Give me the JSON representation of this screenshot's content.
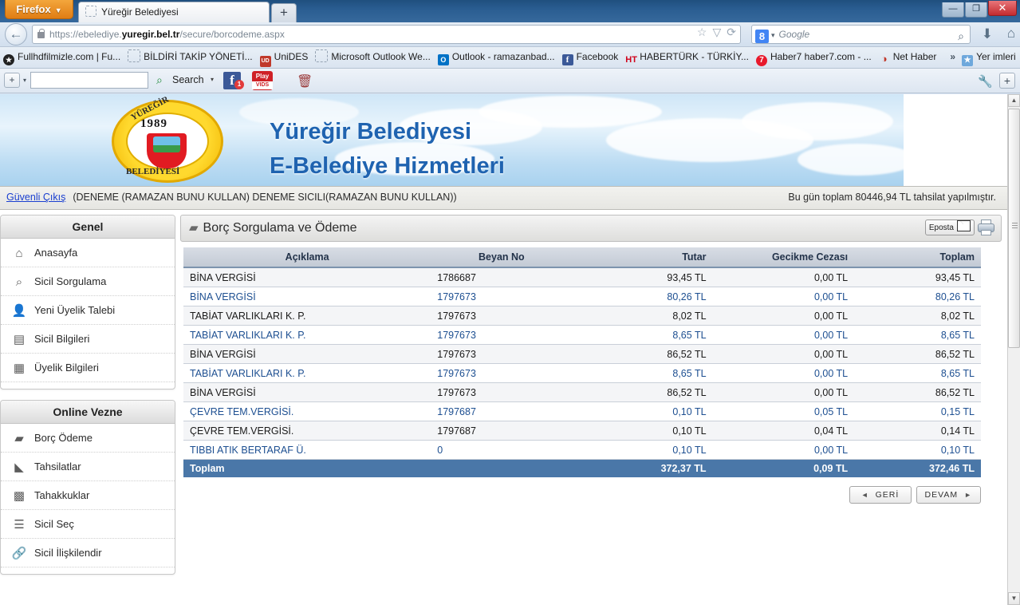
{
  "browser": {
    "firefox_button": "Firefox",
    "tab_title": "Yüreğir Belediyesi",
    "newtab_label": "+",
    "window_minimize": "—",
    "window_restore": "❐",
    "window_close": "✕",
    "url_scheme": "https://ebelediye.",
    "url_domain": "yuregir.bel.tr",
    "url_path": "/secure/borcodeme.aspx",
    "search_engine": "Google",
    "search_placeholder": "Google",
    "google_mark": "8"
  },
  "bookmarks": [
    {
      "label": "Fullhdfilmizle.com | Fu...",
      "icon": "film-icon",
      "glyph": "★"
    },
    {
      "label": "BİLDİRİ TAKİP YÖNETİ...",
      "icon": "blank-favicon",
      "glyph": ""
    },
    {
      "label": "UniDES",
      "icon": "unides-icon",
      "glyph": "UD"
    },
    {
      "label": "Microsoft Outlook We...",
      "icon": "blank-favicon",
      "glyph": ""
    },
    {
      "label": "Outlook - ramazanbad...",
      "icon": "outlook-icon",
      "glyph": "O"
    },
    {
      "label": "Facebook",
      "icon": "facebook-icon",
      "glyph": "f"
    },
    {
      "label": "HABERTÜRK - TÜRKİY...",
      "icon": "haberturk-icon",
      "glyph": "HT"
    },
    {
      "label": "Haber7 haber7.com - ...",
      "icon": "haber7-icon",
      "glyph": "7"
    },
    {
      "label": "Net Haber",
      "icon": "nethaber-icon",
      "glyph": "◑"
    }
  ],
  "bookmarks_overflow": "»",
  "bookmarks_folder": "Yer imleri",
  "addonbar": {
    "plus_label": "+",
    "input_value": "",
    "search_label": "Search",
    "facebook_badge": "1",
    "playvids_line1": "Play",
    "playvids_line2": "VIDS"
  },
  "site": {
    "title_line1": "Yüreğir Belediyesi",
    "title_line2": "E-Belediye Hizmetleri",
    "logo_year": "1989",
    "logo_top_text": "YÜREĞİR",
    "logo_bottom_text": "BELEDİYESİ"
  },
  "userbar": {
    "logout_link": "Güvenli Çıkış",
    "user_info": "(DENEME (RAMAZAN BUNU KULLAN) DENEME SICILI(RAMAZAN BUNU KULLAN))",
    "daily_total": "Bu gün toplam 80446,94 TL tahsilat yapılmıştır."
  },
  "sidebar": {
    "sections": [
      {
        "title": "Genel",
        "items": [
          {
            "label": "Anasayfa",
            "icon": "home-icon",
            "glyph": "⌂"
          },
          {
            "label": "Sicil Sorgulama",
            "icon": "magnifier-icon",
            "glyph": "⌕"
          },
          {
            "label": "Yeni Üyelik Talebi",
            "icon": "add-user-icon",
            "glyph": "👤"
          },
          {
            "label": "Sicil Bilgileri",
            "icon": "document-icon",
            "glyph": "▤"
          },
          {
            "label": "Üyelik Bilgileri",
            "icon": "document-edit-icon",
            "glyph": "▦"
          }
        ]
      },
      {
        "title": "Online Vezne",
        "items": [
          {
            "label": "Borç Ödeme",
            "icon": "cards-icon",
            "glyph": "▱"
          },
          {
            "label": "Tahsilatlar",
            "icon": "chart-down-icon",
            "glyph": "◣"
          },
          {
            "label": "Tahakkuklar",
            "icon": "bar-chart-icon",
            "glyph": "▮"
          },
          {
            "label": "Sicil Seç",
            "icon": "list-edit-icon",
            "glyph": "☰"
          },
          {
            "label": "Sicil İlişkilendir",
            "icon": "link-icon",
            "glyph": "🔗"
          }
        ]
      }
    ]
  },
  "main": {
    "panel_title": "Borç Sorgulama ve Ödeme",
    "panel_icon": "cards-icon",
    "eposta_button": "Eposta",
    "print_icon": "printer-icon",
    "back_button": "GERİ",
    "next_button": "DEVAM",
    "back_arrow": "◄",
    "next_arrow": "►"
  },
  "table": {
    "headers": [
      "Açıklama",
      "Beyan No",
      "Tutar",
      "Gecikme Cezası",
      "Toplam"
    ],
    "rows": [
      {
        "aciklama": "BİNA VERGİSİ",
        "beyan": "1786687",
        "tutar": "93,45 TL",
        "gecikme": "0,00 TL",
        "toplam": "93,45 TL",
        "blue": false
      },
      {
        "aciklama": "BİNA VERGİSİ",
        "beyan": "1797673",
        "tutar": "80,26 TL",
        "gecikme": "0,00 TL",
        "toplam": "80,26 TL",
        "blue": true
      },
      {
        "aciklama": "TABİAT VARLIKLARI K. P.",
        "beyan": "1797673",
        "tutar": "8,02 TL",
        "gecikme": "0,00 TL",
        "toplam": "8,02 TL",
        "blue": false
      },
      {
        "aciklama": "TABİAT VARLIKLARI K. P.",
        "beyan": "1797673",
        "tutar": "8,65 TL",
        "gecikme": "0,00 TL",
        "toplam": "8,65 TL",
        "blue": true
      },
      {
        "aciklama": "BİNA VERGİSİ",
        "beyan": "1797673",
        "tutar": "86,52 TL",
        "gecikme": "0,00 TL",
        "toplam": "86,52 TL",
        "blue": false
      },
      {
        "aciklama": "TABİAT VARLIKLARI K. P.",
        "beyan": "1797673",
        "tutar": "8,65 TL",
        "gecikme": "0,00 TL",
        "toplam": "8,65 TL",
        "blue": true
      },
      {
        "aciklama": "BİNA VERGİSİ",
        "beyan": "1797673",
        "tutar": "86,52 TL",
        "gecikme": "0,00 TL",
        "toplam": "86,52 TL",
        "blue": false
      },
      {
        "aciklama": "ÇEVRE TEM.VERGİSİ.",
        "beyan": "1797687",
        "tutar": "0,10 TL",
        "gecikme": "0,05 TL",
        "toplam": "0,15 TL",
        "blue": true
      },
      {
        "aciklama": "ÇEVRE TEM.VERGİSİ.",
        "beyan": "1797687",
        "tutar": "0,10 TL",
        "gecikme": "0,04 TL",
        "toplam": "0,14 TL",
        "blue": false
      },
      {
        "aciklama": "TIBBI ATIK BERTARAF Ü.",
        "beyan": "0",
        "tutar": "0,10 TL",
        "gecikme": "0,00 TL",
        "toplam": "0,10 TL",
        "blue": true
      }
    ],
    "total_row": {
      "label": "Toplam",
      "beyan": "",
      "tutar": "372,37 TL",
      "gecikme": "0,09 TL",
      "toplam": "372,46 TL"
    }
  },
  "colors": {
    "accent_blue": "#1d4f91",
    "total_bar": "#4a77a8",
    "brand_title": "#1f63b0",
    "link": "#1a3fd0"
  }
}
